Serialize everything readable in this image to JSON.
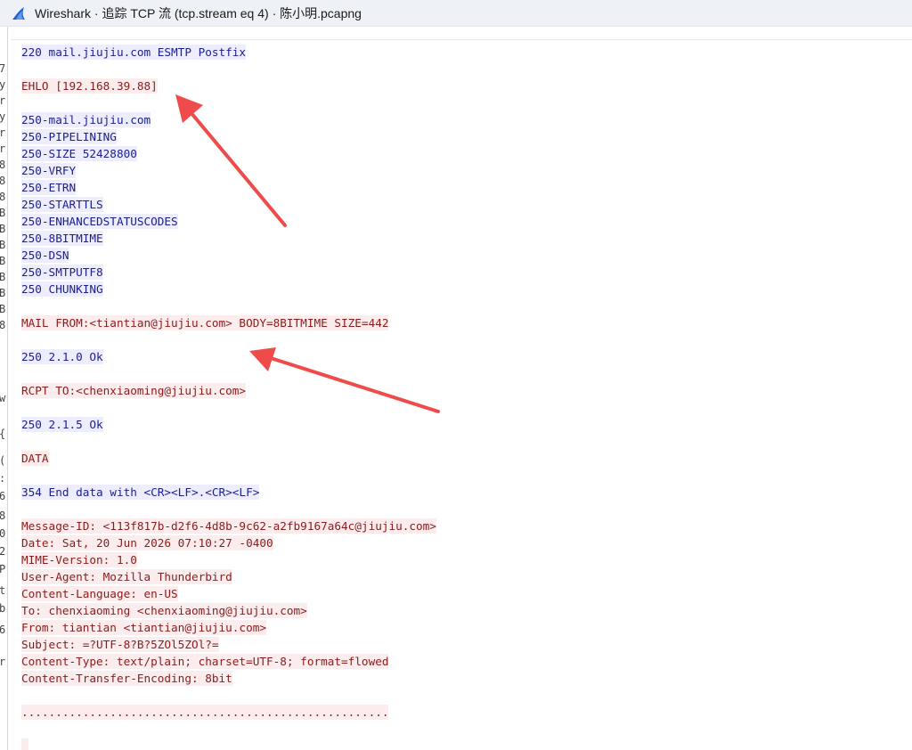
{
  "window": {
    "title": "Wireshark · 追踪 TCP 流 (tcp.stream eq 4) · 陈小明.pcapng",
    "icon": "wireshark-fin-icon",
    "accent": "#1e63d6"
  },
  "left_pane_fragments": [
    "7",
    "y",
    "r",
    "y",
    "r",
    "r",
    "8",
    "8",
    "8",
    "B",
    "B",
    "B",
    "B",
    "B",
    "B",
    "B",
    "8",
    "w",
    "{",
    "(",
    ":",
    "6",
    "8",
    "0",
    "2",
    "P",
    "t",
    "b",
    "6",
    "r"
  ],
  "stream": {
    "client_color": "#8b1b1b",
    "client_bg": "#fbeded",
    "server_color": "#1b1f8c",
    "server_bg": "#ededfd",
    "lines": [
      {
        "dir": "srv",
        "text": "220 mail.jiujiu.com ESMTP Postfix"
      },
      {
        "dir": "blank",
        "text": ""
      },
      {
        "dir": "cli",
        "text": "EHLO [192.168.39.88]"
      },
      {
        "dir": "blank",
        "text": ""
      },
      {
        "dir": "srv",
        "text": "250-mail.jiujiu.com"
      },
      {
        "dir": "srv",
        "text": "250-PIPELINING"
      },
      {
        "dir": "srv",
        "text": "250-SIZE 52428800"
      },
      {
        "dir": "srv",
        "text": "250-VRFY"
      },
      {
        "dir": "srv",
        "text": "250-ETRN"
      },
      {
        "dir": "srv",
        "text": "250-STARTTLS"
      },
      {
        "dir": "srv",
        "text": "250-ENHANCEDSTATUSCODES"
      },
      {
        "dir": "srv",
        "text": "250-8BITMIME"
      },
      {
        "dir": "srv",
        "text": "250-DSN"
      },
      {
        "dir": "srv",
        "text": "250-SMTPUTF8"
      },
      {
        "dir": "srv",
        "text": "250 CHUNKING"
      },
      {
        "dir": "blank",
        "text": ""
      },
      {
        "dir": "cli",
        "text": "MAIL FROM:<tiantian@jiujiu.com> BODY=8BITMIME SIZE=442"
      },
      {
        "dir": "blank",
        "text": ""
      },
      {
        "dir": "srv",
        "text": "250 2.1.0 Ok"
      },
      {
        "dir": "blank",
        "text": ""
      },
      {
        "dir": "cli",
        "text": "RCPT TO:<chenxiaoming@jiujiu.com>"
      },
      {
        "dir": "blank",
        "text": ""
      },
      {
        "dir": "srv",
        "text": "250 2.1.5 Ok"
      },
      {
        "dir": "blank",
        "text": ""
      },
      {
        "dir": "cli",
        "text": "DATA"
      },
      {
        "dir": "blank",
        "text": ""
      },
      {
        "dir": "srv",
        "text": "354 End data with <CR><LF>.<CR><LF>"
      },
      {
        "dir": "blank",
        "text": ""
      },
      {
        "dir": "cli",
        "text": "Message-ID: <113f817b-d2f6-4d8b-9c62-a2fb9167a64c@jiujiu.com>"
      },
      {
        "dir": "cli",
        "text": "Date: Sat, 20 Jun 2026 07:10:27 -0400"
      },
      {
        "dir": "cli",
        "text": "MIME-Version: 1.0"
      },
      {
        "dir": "cli",
        "text": "User-Agent: Mozilla Thunderbird"
      },
      {
        "dir": "cli",
        "text": "Content-Language: en-US"
      },
      {
        "dir": "cli",
        "text": "To: chenxiaoming <chenxiaoming@jiujiu.com>"
      },
      {
        "dir": "cli",
        "text": "From: tiantian <tiantian@jiujiu.com>"
      },
      {
        "dir": "cli",
        "text": "Subject: =?UTF-8?B?5ZOl5ZOl?="
      },
      {
        "dir": "cli",
        "text": "Content-Type: text/plain; charset=UTF-8; format=flowed"
      },
      {
        "dir": "cli",
        "text": "Content-Transfer-Encoding: 8bit"
      },
      {
        "dir": "blank",
        "text": ""
      },
      {
        "dir": "cli",
        "text": "......................................................"
      },
      {
        "dir": "blank",
        "text": ""
      },
      {
        "dir": "cli",
        "text": " "
      }
    ]
  },
  "annotations": {
    "arrow_color": "#f04b4b"
  }
}
